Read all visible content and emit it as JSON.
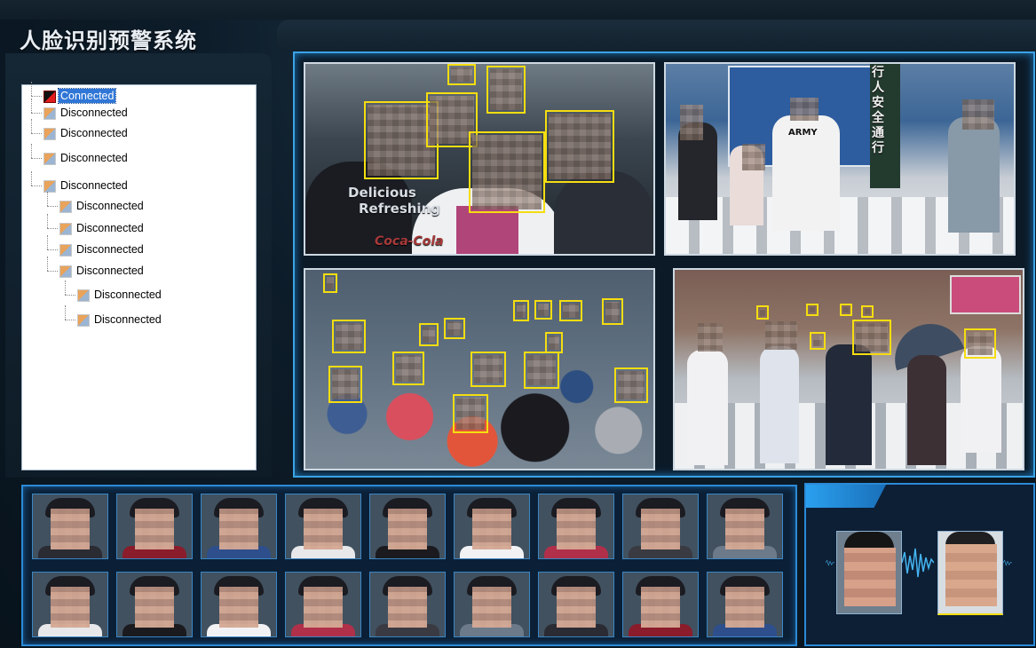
{
  "app": {
    "title": "人脸识别预警系统"
  },
  "device_tree": {
    "items": [
      {
        "label": "Connected",
        "status": "connected",
        "selected": true,
        "level": 0
      },
      {
        "label": "Disconnected",
        "status": "disconnected",
        "level": 0
      },
      {
        "label": "Disconnected",
        "status": "disconnected",
        "level": 0
      },
      {
        "label": "Disconnected",
        "status": "disconnected",
        "level": 0
      },
      {
        "label": "Disconnected",
        "status": "disconnected",
        "level": 0
      },
      {
        "label": "Disconnected",
        "status": "disconnected",
        "level": 1
      },
      {
        "label": "Disconnected",
        "status": "disconnected",
        "level": 1
      },
      {
        "label": "Disconnected",
        "status": "disconnected",
        "level": 1
      },
      {
        "label": "Disconnected",
        "status": "disconnected",
        "level": 1
      },
      {
        "label": "Disconnected",
        "status": "disconnected",
        "level": 2
      },
      {
        "label": "Disconnected",
        "status": "disconnected",
        "level": 2
      }
    ]
  },
  "cameras": {
    "cam1": {
      "shirt_text_1": "Delicious",
      "shirt_text_2": "Refreshing",
      "shirt_text_3": "Coca-Cola"
    },
    "cam2": {
      "shirt_text": "ARMY",
      "sign_text": "行人安全通行"
    }
  },
  "capture_strip": {
    "thumbnails_per_row": 9,
    "rows": 2
  },
  "colors": {
    "accent": "#2b8ad6",
    "face_box": "#f5dd10",
    "selected": "#2f76d6"
  }
}
